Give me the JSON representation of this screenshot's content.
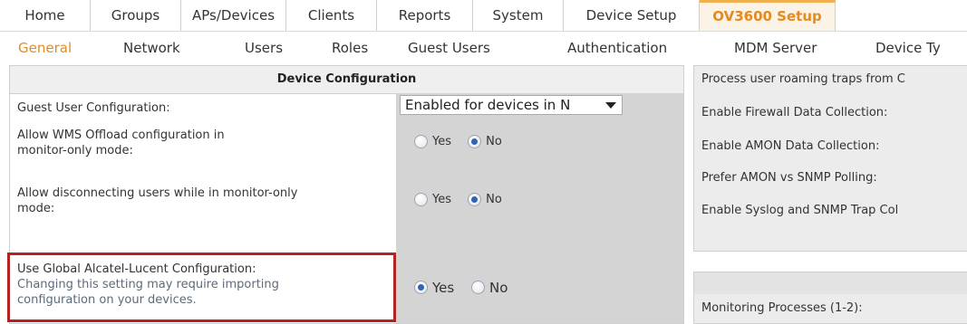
{
  "top_nav": {
    "tabs": [
      "Home",
      "Groups",
      "APs/Devices",
      "Clients",
      "Reports",
      "System",
      "Device Setup",
      "OV3600 Setup"
    ],
    "active": "OV3600 Setup"
  },
  "sub_nav": {
    "tabs": [
      "General",
      "Network",
      "Users",
      "Roles",
      "Guest Users",
      "Authentication",
      "MDM Server",
      "Device Ty"
    ],
    "active": "General"
  },
  "device_config": {
    "title": "Device Configuration",
    "guest_user": {
      "label": "Guest User Configuration:",
      "value": "Enabled for devices in N"
    },
    "wms_offload": {
      "label_line1": "Allow WMS Offload configuration in",
      "label_line2": "monitor-only mode:",
      "yes": "Yes",
      "no": "No",
      "selected": "No"
    },
    "disconnect_users": {
      "label_line1": "Allow disconnecting users while in monitor-only",
      "label_line2": "mode:",
      "yes": "Yes",
      "no": "No",
      "selected": "No"
    },
    "global_config": {
      "label": "Use Global Alcatel-Lucent Configuration:",
      "note_line1": "Changing this setting may require importing",
      "note_line2": "configuration on your devices.",
      "yes": "Yes",
      "no": "No",
      "selected": "Yes"
    }
  },
  "right_panel": {
    "items": [
      "Process user roaming traps from C",
      "Enable Firewall Data Collection:",
      "Enable AMON Data Collection:",
      "Prefer AMON vs SNMP Polling:",
      "Enable Syslog and SNMP Trap Col"
    ],
    "monitoring": "Monitoring Processes (1-2):"
  },
  "colors": {
    "accent": "#e58a1f",
    "highlight_border": "#b52222",
    "value_column": "#d4d4d4"
  }
}
